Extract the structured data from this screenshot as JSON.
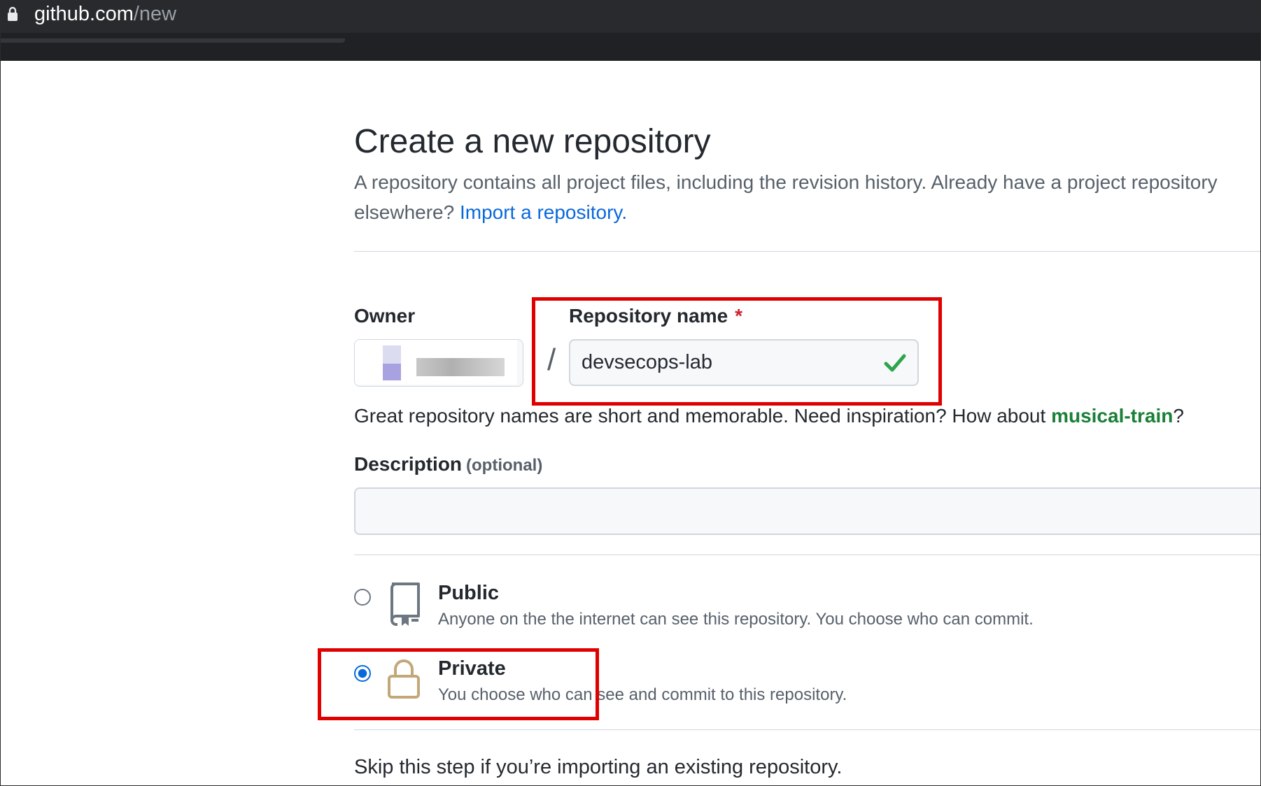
{
  "browser": {
    "url_host": "github.com",
    "url_path": "/new"
  },
  "page": {
    "title": "Create a new repository",
    "subtitle_text": "A repository contains all project files, including the revision history. Already have a project repository elsewhere?",
    "import_link": "Import a repository."
  },
  "form": {
    "owner_label": "Owner",
    "repo_label": "Repository name",
    "required_mark": "*",
    "separator": "/",
    "repo_value": "devsecops-lab",
    "hint_prefix": "Great repository names are short and memorable. Need inspiration? How about ",
    "hint_suggestion": "musical-train",
    "hint_suffix": "?",
    "description_label": "Description",
    "description_optional": "(optional)",
    "description_value": ""
  },
  "visibility": {
    "selected": "Private",
    "options": [
      {
        "title": "Public",
        "description": "Anyone on the the internet can see this repository. You choose who can commit.",
        "icon": "repo-icon",
        "checked": false
      },
      {
        "title": "Private",
        "description": "You choose who can see and commit to this repository.",
        "icon": "lock-icon",
        "checked": true
      }
    ]
  },
  "footer": {
    "skip_text": "Skip this step if you’re importing an existing repository."
  },
  "colors": {
    "link": "#0969da",
    "success": "#1a7f37",
    "annotation": "#e00000",
    "radio_selected": "#0969da"
  }
}
